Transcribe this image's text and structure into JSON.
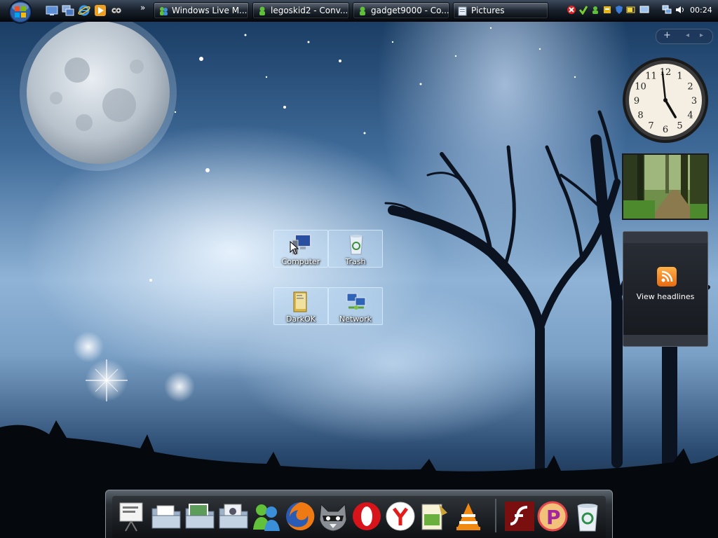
{
  "taskbar": {
    "start_button": "Start",
    "quick_launch": [
      "show-desktop",
      "switch-windows",
      "internet-explorer",
      "media-player",
      "owl"
    ],
    "overflow_chevron": "»",
    "tasks": [
      {
        "label": "Windows Live M...",
        "icon": "messenger-icon"
      },
      {
        "label": "legoskid2 - Conv...",
        "icon": "messenger-icon"
      },
      {
        "label": "gadget9000 - Co...",
        "icon": "messenger-icon"
      },
      {
        "label": "Pictures",
        "icon": "folder-icon"
      }
    ],
    "tray_icons": [
      "close-red-icon",
      "antivirus-icon",
      "messenger-tray-icon",
      "update-icon",
      "shield-icon",
      "battery-icon",
      "display-icon",
      "network-icon",
      "volume-icon"
    ],
    "clock": "00:24"
  },
  "sidebar": {
    "add_label": "+",
    "prev_label": "◂",
    "next_label": "▸"
  },
  "gadgets": {
    "clock": {
      "numbers": [
        "12",
        "1",
        "2",
        "3",
        "4",
        "5",
        "6",
        "7",
        "8",
        "9",
        "10",
        "11"
      ],
      "time": "04:59"
    },
    "feed": {
      "label": "View headlines"
    }
  },
  "desktop_icons": [
    {
      "label": "Computer",
      "icon": "computer-icon"
    },
    {
      "label": "Trash",
      "icon": "trash-icon"
    },
    {
      "label": "DarkOK",
      "icon": "folder-icon"
    },
    {
      "label": "Network",
      "icon": "network-icon"
    }
  ],
  "dock": {
    "items": [
      "presentation",
      "documents",
      "pictures",
      "music",
      "messenger",
      "firefox",
      "raccoon",
      "opera",
      "yandex",
      "notepad",
      "vlc",
      "flash",
      "pidgin-p",
      "recycle-bin"
    ]
  },
  "colors": {
    "sky_light": "#dcebf8",
    "sky_dark": "#14365c",
    "taskbar": "#05090e",
    "feed_orange": "#f28a1e"
  }
}
